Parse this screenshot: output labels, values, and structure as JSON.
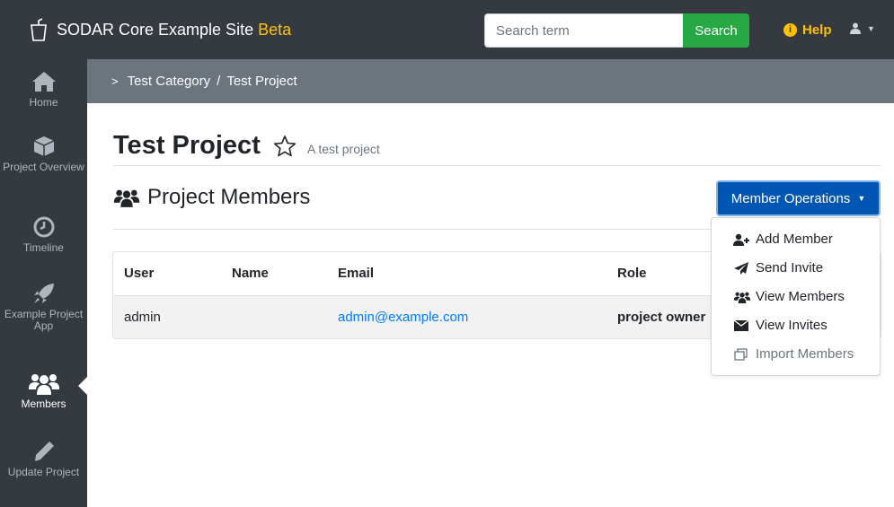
{
  "navbar": {
    "brand_name": "SODAR Core Example Site",
    "brand_badge": "Beta",
    "search_placeholder": "Search term",
    "search_button": "Search",
    "help_label": "Help"
  },
  "sidebar": {
    "items": [
      {
        "label": "Home",
        "icon": "home-icon"
      },
      {
        "label": "Project Overview",
        "icon": "cube-icon"
      },
      {
        "label": "Timeline",
        "icon": "clock-icon"
      },
      {
        "label": "Example Project App",
        "icon": "rocket-icon"
      },
      {
        "label": "Members",
        "icon": "users-icon",
        "active": true
      },
      {
        "label": "Update Project",
        "icon": "pencil-icon"
      }
    ]
  },
  "breadcrumb": {
    "category": "Test Category",
    "separator": "/",
    "project": "Test Project"
  },
  "page": {
    "title": "Test Project",
    "description": "A test project",
    "section_title": "Project Members",
    "ops_button": "Member Operations"
  },
  "table": {
    "headers": [
      "User",
      "Name",
      "Email",
      "Role"
    ],
    "rows": [
      {
        "user": "admin",
        "name": "",
        "email": "admin@example.com",
        "role": "project owner"
      }
    ]
  },
  "dropdown": {
    "items": [
      {
        "label": "Add Member",
        "icon": "user-plus-icon",
        "enabled": true
      },
      {
        "label": "Send Invite",
        "icon": "paper-plane-icon",
        "enabled": true
      },
      {
        "label": "View Members",
        "icon": "users-icon",
        "enabled": true
      },
      {
        "label": "View Invites",
        "icon": "envelope-icon",
        "enabled": true
      },
      {
        "label": "Import Members",
        "icon": "copy-icon",
        "enabled": false
      }
    ]
  },
  "colors": {
    "navbar": "#343a40",
    "beta": "#ffc107",
    "search_button": "#28a745",
    "primary": "#0056b3",
    "link": "#007bff",
    "breadcrumb_bar": "#6c757d"
  }
}
